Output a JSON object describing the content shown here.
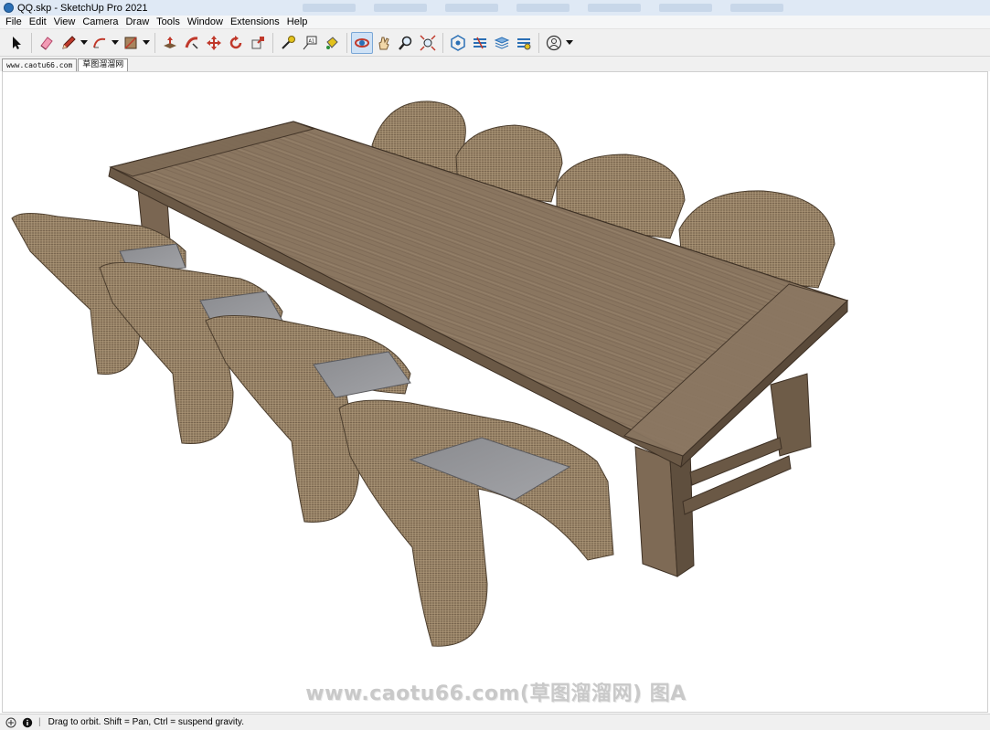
{
  "window": {
    "title": "QQ.skp - SketchUp Pro 2021"
  },
  "menu": [
    "File",
    "Edit",
    "View",
    "Camera",
    "Draw",
    "Tools",
    "Window",
    "Extensions",
    "Help"
  ],
  "toolbar": {
    "tools": [
      "select-icon",
      "eraser-icon",
      "pencil-icon",
      "arc-icon",
      "rectangle-icon",
      "push-pull-icon",
      "follow-me-icon",
      "move-icon",
      "rotate-icon",
      "scale-icon",
      "tape-measure-icon",
      "text-icon",
      "paint-bucket-icon",
      "orbit-icon",
      "pan-icon",
      "zoom-icon",
      "zoom-extents-icon",
      "warehouse-icon",
      "extension-warehouse-icon",
      "layout-icon",
      "extension-manager-icon",
      "profile-icon"
    ],
    "active_tool": "orbit-icon"
  },
  "scenes": {
    "tabs": [
      "www.caotu66.com",
      "草图溜溜网"
    ],
    "active_index": 1
  },
  "viewport": {
    "watermark": "www.caotu66.com(草图溜溜网) 图A"
  },
  "statusbar": {
    "hint": "Drag to orbit. Shift = Pan, Ctrl = suspend gravity."
  },
  "colors": {
    "wood": "#8a7660",
    "wicker": "#a08a70",
    "cushion": "#8f9094",
    "accent": "#2a6fb5"
  }
}
